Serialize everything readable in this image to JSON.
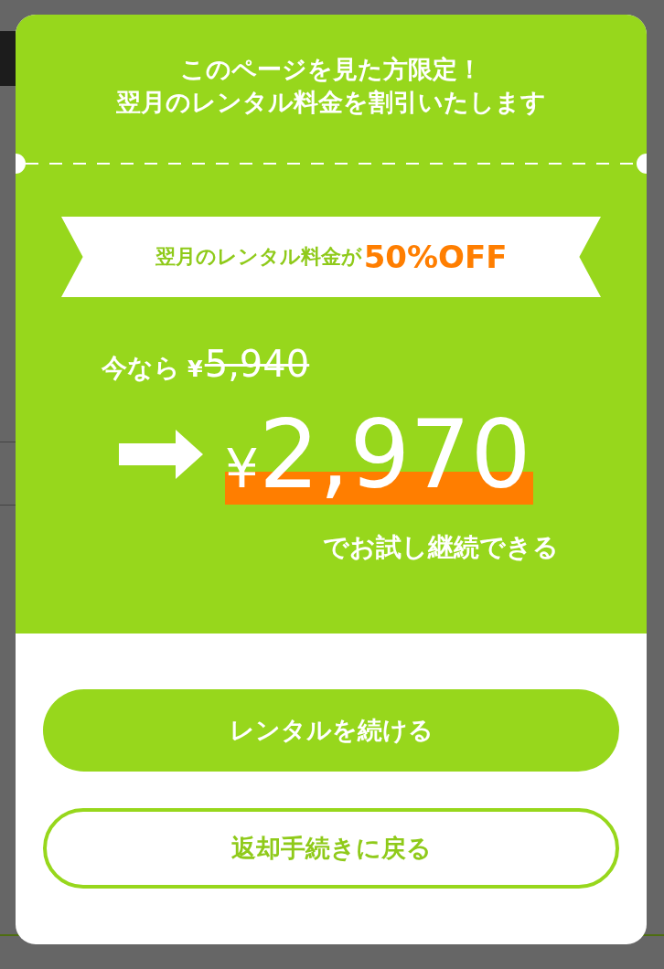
{
  "modal": {
    "headline": [
      "このページを見た方限定！",
      "翌月のレンタル料金を割引いたします"
    ],
    "ribbon": {
      "label": "翌月のレンタル料金が",
      "highlight": "50%OFF"
    },
    "offer": {
      "prefix": "今なら",
      "old_currency": "¥",
      "old_amount": "5,940",
      "new_currency": "¥",
      "new_amount": "2,970",
      "note": "でお試し継続できる"
    },
    "buttons": [
      {
        "label": "レンタルを続ける",
        "kind": "primary"
      },
      {
        "label": "返却手続きに戻る",
        "kind": "secondary"
      }
    ]
  }
}
